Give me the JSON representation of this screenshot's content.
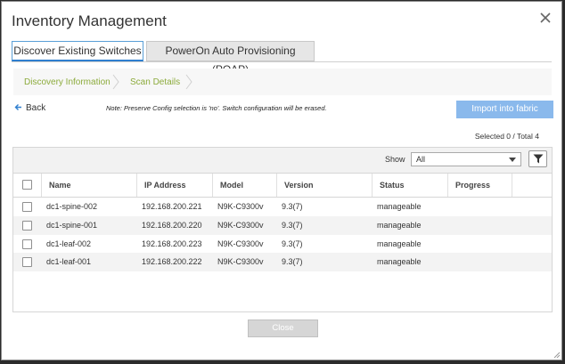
{
  "dialog": {
    "title": "Inventory Management"
  },
  "tabs": [
    {
      "label": "Discover Existing Switches",
      "active": true
    },
    {
      "label": "PowerOn Auto Provisioning (POAP)",
      "active": false
    }
  ],
  "wizard": {
    "steps": [
      "Discovery Information",
      "Scan Details"
    ]
  },
  "back_label": "Back",
  "note": "Note: Preserve Config selection is 'no'. Switch configuration will be erased.",
  "import_button": "Import into fabric",
  "selection": {
    "text": "Selected 0 / Total 4"
  },
  "filter": {
    "show_label": "Show",
    "selected": "All"
  },
  "table": {
    "columns": [
      "Name",
      "IP Address",
      "Model",
      "Version",
      "Status",
      "Progress"
    ],
    "rows": [
      {
        "name": "dc1-spine-002",
        "ip": "192.168.200.221",
        "model": "N9K-C9300v",
        "version": "9.3(7)",
        "status": "manageable",
        "progress": ""
      },
      {
        "name": "dc1-spine-001",
        "ip": "192.168.200.220",
        "model": "N9K-C9300v",
        "version": "9.3(7)",
        "status": "manageable",
        "progress": ""
      },
      {
        "name": "dc1-leaf-002",
        "ip": "192.168.200.223",
        "model": "N9K-C9300v",
        "version": "9.3(7)",
        "status": "manageable",
        "progress": ""
      },
      {
        "name": "dc1-leaf-001",
        "ip": "192.168.200.222",
        "model": "N9K-C9300v",
        "version": "9.3(7)",
        "status": "manageable",
        "progress": ""
      }
    ]
  },
  "close_button": "Close",
  "colors": {
    "accent": "#2f7fcf",
    "step_text": "#8cab3c",
    "import_button": "#8ab9ec"
  },
  "icons": [
    "close-icon",
    "back-arrow-icon",
    "chevron-right-icon",
    "chevron-down-icon",
    "filter-icon"
  ]
}
